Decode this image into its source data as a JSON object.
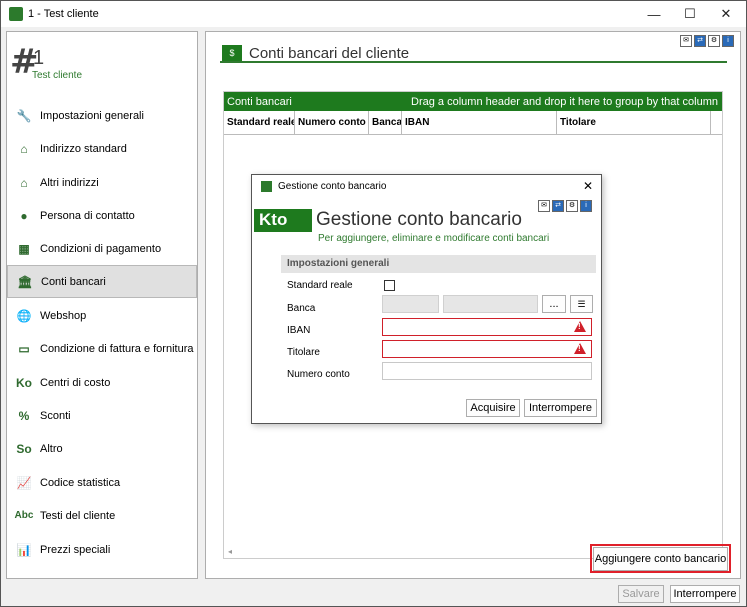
{
  "window": {
    "title": "1 - Test cliente",
    "minimize": "—",
    "maximize": "☐",
    "close": "✕"
  },
  "customer": {
    "number": "1",
    "name": "Test cliente",
    "hash": "#"
  },
  "sidebar": {
    "items": [
      {
        "label": "Impostazioni generali",
        "icon": "wrench-icon",
        "glyph": "🔧"
      },
      {
        "label": "Indirizzo standard",
        "icon": "home-icon",
        "glyph": "⌂"
      },
      {
        "label": "Altri indirizzi",
        "icon": "homes-icon",
        "glyph": "⌂"
      },
      {
        "label": "Persona di contatto",
        "icon": "person-icon",
        "glyph": "●"
      },
      {
        "label": "Condizioni di pagamento",
        "icon": "cash-register-icon",
        "glyph": "▦"
      },
      {
        "label": "Conti bancari",
        "icon": "bank-icon",
        "glyph": "🏛"
      },
      {
        "label": "Webshop",
        "icon": "globe-icon",
        "glyph": "🌐"
      },
      {
        "label": "Condizione di fattura e fornitura",
        "icon": "invoice-icon",
        "glyph": "▭"
      },
      {
        "label": "Centri di costo",
        "icon": "ko-icon",
        "glyph": "Ko"
      },
      {
        "label": "Sconti",
        "icon": "percent-icon",
        "glyph": "%"
      },
      {
        "label": "Altro",
        "icon": "so-icon",
        "glyph": "So"
      },
      {
        "label": "Codice statistica",
        "icon": "line-chart-icon",
        "glyph": "📈"
      },
      {
        "label": "Testi del cliente",
        "icon": "abc-icon",
        "glyph": "Abc"
      },
      {
        "label": "Prezzi speciali",
        "icon": "bar-chart-icon",
        "glyph": "📊"
      }
    ],
    "selected_index": 5
  },
  "main": {
    "title": "Conti bancari del cliente",
    "grid": {
      "caption": "Conti bancari",
      "group_hint": "Drag a column header and drop it here to group by that column",
      "columns": [
        "Standard reale",
        "Numero conto",
        "Banca",
        "IBAN",
        "Titolare"
      ]
    },
    "add_button": "Aggiungere conto bancario"
  },
  "footer": {
    "save": "Salvare",
    "cancel": "Interrompere"
  },
  "dialog": {
    "window_title": "Gestione conto bancario",
    "badge": "Kto",
    "title": "Gestione conto bancario",
    "subtitle": "Per aggiungere, eliminare e modificare conti bancari",
    "section": "Impostazioni generali",
    "labels": {
      "standard": "Standard reale",
      "bank": "Banca",
      "iban": "IBAN",
      "holder": "Titolare",
      "account": "Numero conto"
    },
    "ellipsis": "...",
    "acquire": "Acquisire",
    "cancel": "Interrompere",
    "close": "✕"
  },
  "colors": {
    "accent": "#1e7a1e",
    "error": "#d0202a"
  }
}
